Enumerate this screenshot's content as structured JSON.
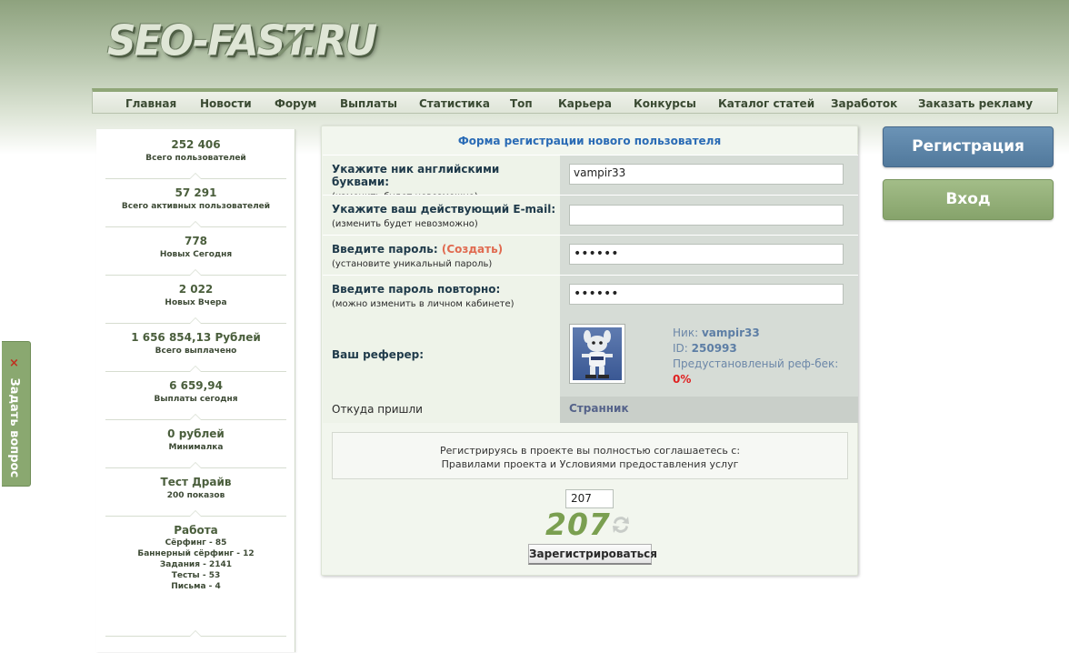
{
  "header": {
    "logo_text": "SEO-FAST.RU"
  },
  "menu": {
    "items": [
      {
        "label": "Главная"
      },
      {
        "label": "Новости"
      },
      {
        "label": "Форум"
      },
      {
        "label": "Выплаты"
      },
      {
        "label": "Статистика"
      },
      {
        "label": "Топ"
      },
      {
        "label": "Карьера"
      },
      {
        "label": "Конкурсы"
      },
      {
        "label": "Каталог статей"
      },
      {
        "label": "Заработок"
      },
      {
        "label": "Заказать рекламу"
      }
    ]
  },
  "sidebar": {
    "stats": [
      {
        "value": "252 406",
        "label": "Всего пользователей"
      },
      {
        "value": "57 291",
        "label": "Всего активных пользователей"
      },
      {
        "value": "778",
        "label": "Новых Сегодня"
      },
      {
        "value": "2 022",
        "label": "Новых Вчера"
      },
      {
        "value": "1 656 854,13 Рублей",
        "label": "Всего выплачено"
      },
      {
        "value": "6 659,94",
        "label": "Выплаты сегодня"
      },
      {
        "value": "0 рублей",
        "label": "Минималка"
      },
      {
        "value": "Тест Драйв",
        "label": "200 показов"
      }
    ],
    "work": {
      "title": "Работа",
      "lines": [
        "Сёрфинг - 85",
        "Баннерный сёрфинг - 12",
        "Задания - 2141",
        "Тесты - 53",
        "Письма - 4"
      ]
    }
  },
  "side_tab": {
    "close_glyph": "×",
    "label": "Задать вопрос"
  },
  "form": {
    "title": "Форма регистрации нового пользователя",
    "nick": {
      "label": "Укажите ник английскими буквами:",
      "hint": "(изменить будет невозможно)",
      "value": "vampir33"
    },
    "email": {
      "label": "Укажите ваш действующий E-mail:",
      "hint": "(изменить будет невозможно)",
      "value": ""
    },
    "password": {
      "label": "Введите пароль:",
      "create_link": "(Создать)",
      "hint": "(установите уникальный пароль)",
      "value": "••••••"
    },
    "password_repeat": {
      "label": "Введите пароль повторно:",
      "hint": "(можно изменить в личном кабинете)",
      "value": "••••••"
    },
    "referrer": {
      "label": "Ваш реферер:",
      "nick_label": "Ник:",
      "nick": "vampir33",
      "id_label": "ID:",
      "id": "250993",
      "refback_label": "Предустановленый реф-бек:",
      "refback": "0%"
    },
    "source": {
      "label": "Откуда пришли",
      "value": "Странник"
    },
    "agreement": {
      "line1": "Регистрируясь в проекте вы полностью соглашаетесь с:",
      "line2": "Правилами проекта и Условиями предоставления услуг"
    },
    "captcha": {
      "input_value": "207",
      "image_text": "207"
    },
    "submit_label": "Зарегистрироваться"
  },
  "right_buttons": {
    "register_label": "Регистрация",
    "login_label": "Вход"
  },
  "colors": {
    "accent_green": "#8fa678",
    "title_blue": "#2a6bb5",
    "register_blue": "#5a82a6",
    "login_green": "#94b079",
    "refback_red": "#e02020"
  }
}
